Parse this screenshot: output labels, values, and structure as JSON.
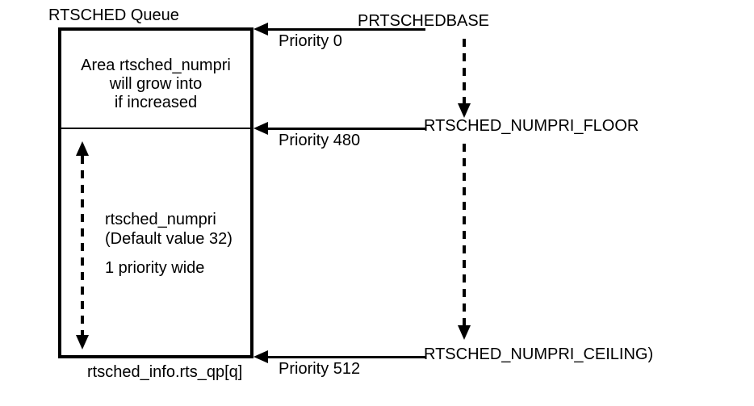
{
  "title": "RTSCHED Queue",
  "upperBox": {
    "line1": "Area rtsched_numpri",
    "line2": "will grow into",
    "line3": "if increased"
  },
  "lowerBox": {
    "line1": "rtsched_numpri",
    "line2": "(Default value 32)",
    "line3": "1 priority wide"
  },
  "bottomLabel": "rtsched_info.rts_qp[q]",
  "arrows": {
    "p0": {
      "label": "Priority 0",
      "target": "PRTSCHEDBASE"
    },
    "p480": {
      "label": "Priority 480",
      "target": "RTSCHED_NUMPRI_FLOOR"
    },
    "p512": {
      "label": "Priority 512",
      "target": "RTSCHED_NUMPRI_CEILING)"
    }
  },
  "values": {
    "PRTSCHEDBASE": 0,
    "RTSCHED_NUMPRI_FLOOR": 480,
    "RTSCHED_NUMPRI_CEILING": 512,
    "rtsched_numpri_default": 32
  }
}
